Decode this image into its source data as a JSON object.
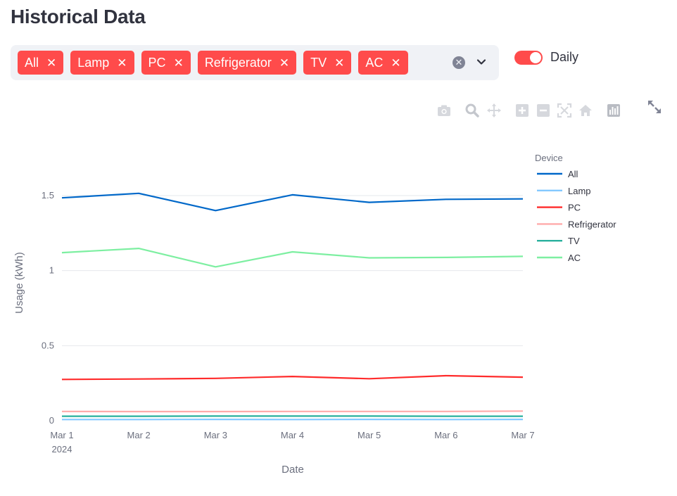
{
  "header": {
    "title": "Historical Data"
  },
  "filter": {
    "tags": [
      {
        "label": "All"
      },
      {
        "label": "Lamp"
      },
      {
        "label": "PC"
      },
      {
        "label": "Refrigerator"
      },
      {
        "label": "TV"
      },
      {
        "label": "AC"
      }
    ],
    "remove_glyph": "✕",
    "clear_glyph": "✕"
  },
  "toggle": {
    "label": "Daily",
    "checked": true
  },
  "modebar": {
    "icons": [
      "camera-icon",
      "zoom-icon",
      "pan-icon",
      "zoom-in-icon",
      "zoom-out-icon",
      "autoscale-icon",
      "reset-axes-icon",
      "chart-icon"
    ]
  },
  "chart_data": {
    "type": "line",
    "x": [
      "2024-03-01",
      "2024-03-02",
      "2024-03-03",
      "2024-03-04",
      "2024-03-05",
      "2024-03-06",
      "2024-03-07"
    ],
    "x_tick_labels": [
      "Mar 1",
      "Mar 2",
      "Mar 3",
      "Mar 4",
      "Mar 5",
      "Mar 6",
      "Mar 7"
    ],
    "x_tick_sublabel": "2024",
    "xlabel": "Date",
    "ylabel": "Usage (kWh)",
    "ylim": [
      -0.02,
      1.78
    ],
    "y_ticks": [
      0,
      0.5,
      1,
      1.5
    ],
    "y_tick_labels": [
      "0",
      "0.5",
      "1",
      "1.5"
    ],
    "grid": true,
    "legend": {
      "title": "Device",
      "placement": "right"
    },
    "series": [
      {
        "name": "All",
        "color": "#0068c9",
        "values": [
          1.485,
          1.515,
          1.4,
          1.505,
          1.455,
          1.475,
          1.478
        ]
      },
      {
        "name": "Lamp",
        "color": "#83c9ff",
        "values": [
          0.008,
          0.008,
          0.009,
          0.008,
          0.009,
          0.008,
          0.009
        ]
      },
      {
        "name": "PC",
        "color": "#ff2b2b",
        "values": [
          0.275,
          0.278,
          0.282,
          0.295,
          0.28,
          0.3,
          0.29
        ]
      },
      {
        "name": "Refrigerator",
        "color": "#ffabab",
        "values": [
          0.062,
          0.061,
          0.061,
          0.062,
          0.062,
          0.062,
          0.064
        ]
      },
      {
        "name": "TV",
        "color": "#29b09d",
        "values": [
          0.03,
          0.03,
          0.031,
          0.031,
          0.031,
          0.03,
          0.03
        ]
      },
      {
        "name": "AC",
        "color": "#7defa1",
        "values": [
          1.12,
          1.148,
          1.025,
          1.125,
          1.085,
          1.088,
          1.095
        ]
      }
    ]
  }
}
